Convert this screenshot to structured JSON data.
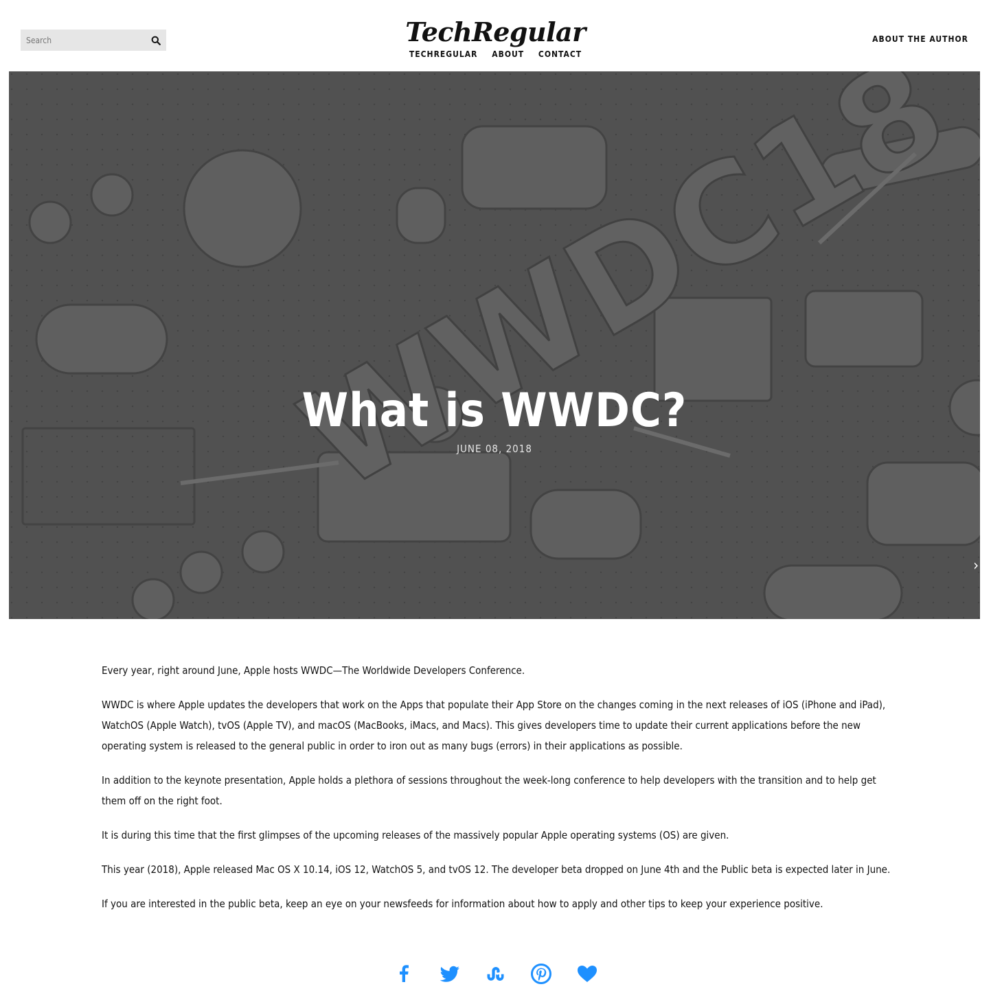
{
  "header": {
    "search_placeholder": "Search",
    "brand": "TechRegular",
    "nav": [
      {
        "label": "TECHREGULAR"
      },
      {
        "label": "ABOUT"
      },
      {
        "label": "CONTACT"
      }
    ],
    "author_link": "ABOUT THE AUTHOR"
  },
  "hero": {
    "title": "What is WWDC?",
    "date": "JUNE 08, 2018",
    "next_arrow": "›"
  },
  "article": {
    "paragraphs": [
      "Every year, right around June, Apple hosts WWDC—The Worldwide Developers Conference.",
      "WWDC is where Apple updates the developers that work on the Apps that populate their App Store on the changes coming in the next releases of iOS (iPhone and iPad), WatchOS (Apple Watch), tvOS (Apple TV), and macOS (MacBooks, iMacs, and Macs). This gives developers time to update their current applications before the new operating system is released to the general public in order to iron out as many bugs (errors) in their applications as possible.",
      "In addition to the keynote presentation, Apple holds a plethora of sessions throughout the week-long conference to help developers with the transition and to help get them off on the right foot.",
      "It is during this time that the first glimpses of the upcoming releases of the massively popular Apple operating systems (OS) are given.",
      "This year (2018), Apple released Mac OS X 10.14, iOS 12, WatchOS 5, and tvOS 12. The developer beta dropped on June 4th and the Public beta is expected later in June.",
      "If you are interested in the public beta, keep an eye on your newsfeeds for information about how to apply and other tips to keep your experience positive."
    ]
  },
  "share": {
    "icons": [
      "facebook-icon",
      "twitter-icon",
      "stumbleupon-icon",
      "pinterest-icon",
      "heart-icon"
    ],
    "color": "#1e90ff"
  },
  "colors": {
    "hero_gray": "#5a5a5a",
    "text": "#111111",
    "search_bg": "#e6e6e6"
  }
}
